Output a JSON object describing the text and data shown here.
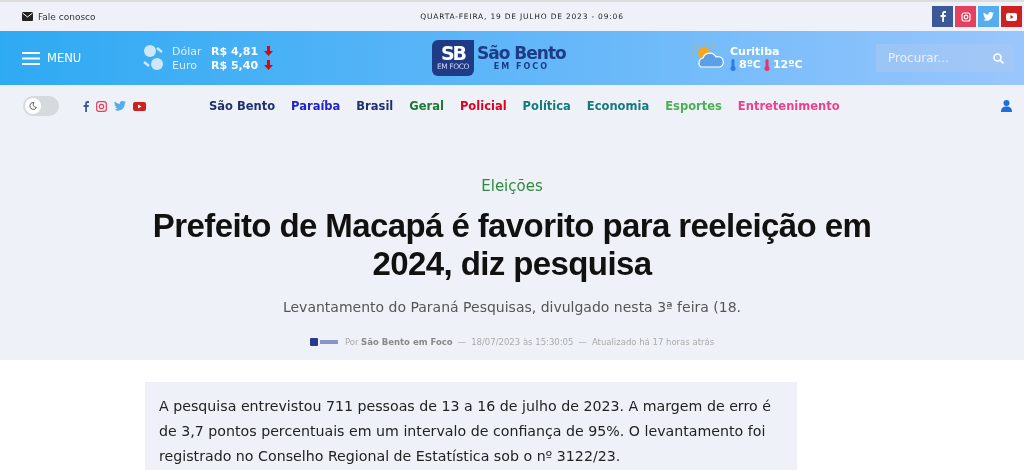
{
  "topbar": {
    "contact": "Fale conosco",
    "date": "QUARTA-FEIRA, 19 DE JULHO DE 2023 - 09:06",
    "social": [
      {
        "kind": "facebook",
        "color": "#3b5998"
      },
      {
        "kind": "instagram",
        "color": "#e4405f"
      },
      {
        "kind": "twitter",
        "color": "#55acee"
      },
      {
        "kind": "youtube",
        "color": "#cd201f"
      }
    ]
  },
  "header": {
    "menu": "MENU",
    "currencies": [
      {
        "name": "Dólar",
        "value": "R$ 4,81",
        "down": true
      },
      {
        "name": "Euro",
        "value": "R$ 5,40",
        "down": true
      }
    ],
    "logo": {
      "mark": "SB",
      "mark_sub": "EM FOCO",
      "name": "São Bento",
      "sub": "EM FOCO"
    },
    "weather": {
      "city": "Curitiba",
      "min": "8ºC",
      "max": "12ºC"
    },
    "search": {
      "placeholder": "Procurar..."
    }
  },
  "nav": {
    "dark_mode": {
      "on": false
    },
    "items": [
      {
        "label": "São Bento",
        "color": "#1e2f6e"
      },
      {
        "label": "Paraíba",
        "color": "#2222cc"
      },
      {
        "label": "Brasil",
        "color": "#1e2f6e"
      },
      {
        "label": "Geral",
        "color": "#1a7a33"
      },
      {
        "label": "Policial",
        "color": "#e0001b"
      },
      {
        "label": "Política",
        "color": "#117a7a"
      },
      {
        "label": "Economia",
        "color": "#117a7a"
      },
      {
        "label": "Esportes",
        "color": "#4caf50"
      },
      {
        "label": "Entretenimento",
        "color": "#ef3e8e"
      }
    ]
  },
  "article": {
    "category": "Eleições",
    "title": "Prefeito de Macapá é favorito para reeleição em 2024, diz pesquisa",
    "subtitle": "Levantamento do Paraná Pesquisas, divulgado nesta 3ª feira (18.",
    "byline": {
      "separator": "—",
      "prefix": "Por",
      "author": "São Bento em Foco",
      "date": "18/07/2023 às 15:30:05",
      "updated": "Atualizado há 17 horas atrás"
    },
    "summary": "A pesquisa entrevistou 711 pessoas de 13 a 16 de julho de 2023. A margem de erro é de 3,7 pontos percentuais em um intervalo de confiança de 95%. O levantamento foi registrado no Conselho Regional de Estatística sob o nº 3122/23."
  }
}
